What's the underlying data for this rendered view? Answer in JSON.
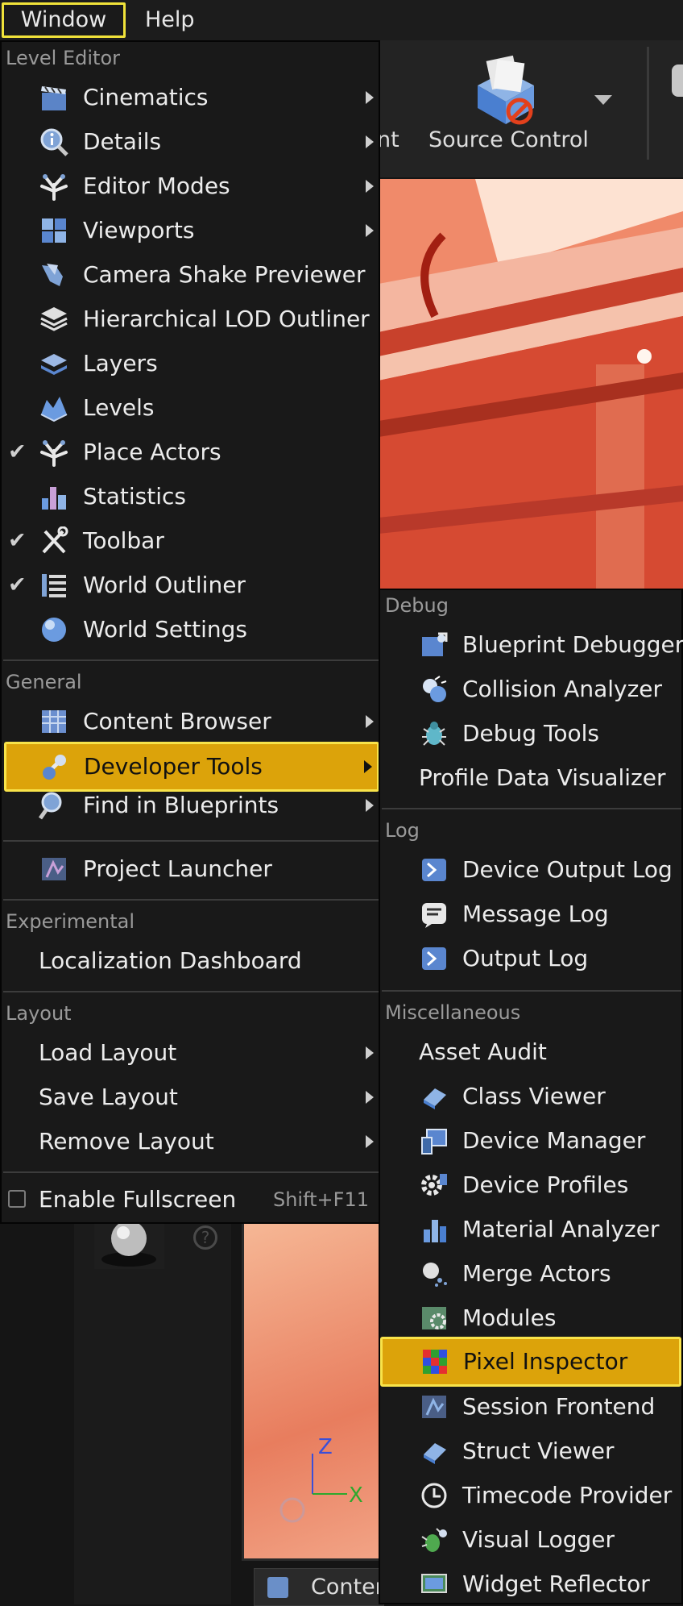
{
  "menubar": {
    "window": "Window",
    "help": "Help"
  },
  "toolbar": {
    "fragment": "nt",
    "source_control": "Source Control"
  },
  "axes": {
    "z": "Z",
    "x": "X"
  },
  "content_tab": "Conter",
  "main_menu": {
    "level_editor": {
      "header": "Level Editor",
      "items": [
        {
          "label": "Cinematics",
          "icon": "clapperboard-icon"
        },
        {
          "label": "Details",
          "icon": "info-magnifier-icon"
        },
        {
          "label": "Editor Modes",
          "icon": "modes-hand-icon"
        },
        {
          "label": "Viewports",
          "icon": "viewport-grid-icon"
        },
        {
          "label": "Camera Shake Previewer",
          "icon": "camera-shake-icon"
        },
        {
          "label": "Hierarchical LOD Outliner",
          "icon": "layers-stack-icon"
        },
        {
          "label": "Layers",
          "icon": "layers-icon"
        },
        {
          "label": "Levels",
          "icon": "levels-icon"
        },
        {
          "label": "Place Actors",
          "icon": "place-actors-icon",
          "checked": true
        },
        {
          "label": "Statistics",
          "icon": "bar-chart-icon"
        },
        {
          "label": "Toolbar",
          "icon": "tools-icon",
          "checked": true
        },
        {
          "label": "World Outliner",
          "icon": "outliner-list-icon",
          "checked": true
        },
        {
          "label": "World Settings",
          "icon": "globe-icon"
        }
      ]
    },
    "general": {
      "header": "General",
      "content_browser": "Content Browser",
      "developer_tools": "Developer Tools",
      "find_in_blueprints": "Find in Blueprints",
      "project_launcher": "Project Launcher"
    },
    "experimental": {
      "header": "Experimental",
      "localization": "Localization Dashboard"
    },
    "layout": {
      "header": "Layout",
      "load": "Load Layout",
      "save": "Save Layout",
      "remove": "Remove Layout"
    },
    "fullscreen": {
      "label": "Enable Fullscreen",
      "shortcut": "Shift+F11"
    }
  },
  "sub_menu": {
    "debug": {
      "header": "Debug",
      "blueprint_debugger": "Blueprint Debugger",
      "collision_analyzer": "Collision Analyzer",
      "debug_tools": "Debug Tools",
      "profile_visualizer": "Profile Data Visualizer"
    },
    "log": {
      "header": "Log",
      "device_output": "Device Output Log",
      "message": "Message Log",
      "output": "Output Log"
    },
    "misc": {
      "header": "Miscellaneous",
      "asset_audit": "Asset Audit",
      "class_viewer": "Class Viewer",
      "device_manager": "Device Manager",
      "device_profiles": "Device Profiles",
      "material_analyzer": "Material Analyzer",
      "merge_actors": "Merge Actors",
      "modules": "Modules",
      "pixel_inspector": "Pixel Inspector",
      "session_frontend": "Session Frontend",
      "struct_viewer": "Struct Viewer",
      "timecode_provider": "Timecode Provider",
      "visual_logger": "Visual Logger",
      "widget_reflector": "Widget Reflector"
    }
  },
  "colors": {
    "highlight": "#dca30a",
    "highlight_border": "#f8e34a",
    "menu_bg": "#191919",
    "viewport": "#e0593e"
  }
}
